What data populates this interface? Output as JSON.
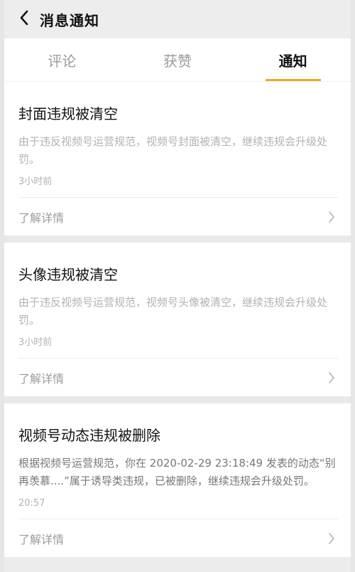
{
  "header": {
    "title": "消息通知",
    "back_icon": "chevron-left-icon"
  },
  "tabs": [
    {
      "label": "评论",
      "active": false
    },
    {
      "label": "获赞",
      "active": false
    },
    {
      "label": "通知",
      "active": true
    }
  ],
  "colors": {
    "accent": "#f0a92a"
  },
  "notifications": [
    {
      "title": "封面违规被清空",
      "body": "由于违反视频号运营规范，视频号封面被清空，继续违规会升级处罚。",
      "time": "3小时前",
      "action_label": "了解详情",
      "action_icon": "chevron-right-icon"
    },
    {
      "title": "头像违规被清空",
      "body": "由于违反视频号运营规范，视频号头像被清空，继续违规会升级处罚。",
      "time": "3小时前",
      "action_label": "了解详情",
      "action_icon": "chevron-right-icon"
    },
    {
      "title": "视频号动态违规被删除",
      "body": "根据视频号运营规范，你在 2020-02-29 23:18:49 发表的动态“别再羡慕....”属于诱导类违规，已被删除，继续违规会升级处罚。",
      "time": "20:57",
      "action_label": "了解详情",
      "action_icon": "chevron-right-icon"
    }
  ]
}
